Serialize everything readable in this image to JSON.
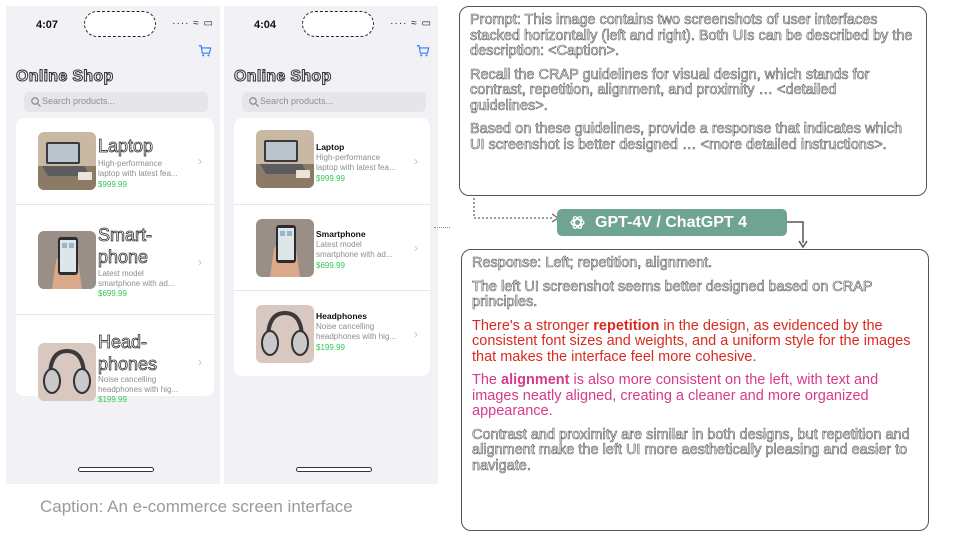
{
  "phones": {
    "left": {
      "time": "4:07",
      "status_icons": "····  ≈  ▭",
      "title": "Online Shop",
      "search_placeholder": "Search products...",
      "items": [
        {
          "name_lines": [
            "Laptop"
          ],
          "desc_lines": [
            "High-performance",
            "laptop with latest fea..."
          ],
          "price": "$999.99",
          "image": "laptop-image"
        },
        {
          "name_lines": [
            "Smart-",
            "phone"
          ],
          "desc_lines": [
            "Latest model",
            "smartphone with ad..."
          ],
          "price": "$699.99",
          "image": "smartphone-image"
        },
        {
          "name_lines": [
            "Head-",
            "phones"
          ],
          "desc_lines": [
            "Noise cancelling",
            "headphones with hig..."
          ],
          "price": "$199.99",
          "image": "headphones-image"
        }
      ]
    },
    "right": {
      "time": "4:04",
      "status_icons": "····  ≈  ▭",
      "title": "Online Shop",
      "search_placeholder": "Search products...",
      "items": [
        {
          "name_lines": [
            "Laptop"
          ],
          "desc_lines": [
            "High-performance",
            "laptop with latest fea..."
          ],
          "price": "$999.99",
          "image": "laptop-image"
        },
        {
          "name_lines": [
            "Smartphone"
          ],
          "desc_lines": [
            "Latest model",
            "smartphone with ad..."
          ],
          "price": "$699.99",
          "image": "smartphone-image"
        },
        {
          "name_lines": [
            "Headphones"
          ],
          "desc_lines": [
            "Noise cancelling",
            "headphones with hig..."
          ],
          "price": "$199.99",
          "image": "headphones-image"
        }
      ]
    }
  },
  "caption": "Caption: An e-commerce screen interface",
  "prompt": {
    "label": "Prompt",
    "p1": ": This image contains two screenshots of user interfaces stacked horizontally (left and right). Both UIs can be described by the description: <Caption>.",
    "p2": "Recall the CRAP guidelines for visual design, which stands for contrast, repetition, alignment, and proximity … <detailed guidelines>.",
    "p3": "Based on these guidelines, provide a response that indicates which UI screenshot is better designed … <more detailed instructions>."
  },
  "model_badge": "GPT-4V / ChatGPT 4",
  "response": {
    "label": "Response",
    "p1_rest": ": Left; repetition, alignment.",
    "p2": "The left UI screenshot seems better designed based on CRAP principles.",
    "p3_pre": "There's a stronger ",
    "p3_bold": "repetition",
    "p3_post": " in the design, as evidenced by the consistent font sizes and weights, and a uniform style for the images that makes the interface feel more cohesive.",
    "p4_pre": "The ",
    "p4_bold": "alignment",
    "p4_post": " is also more consistent on the left, with text and images neatly aligned, creating a cleaner and more organized appearance.",
    "p5": "Contrast and proximity are similar in both designs, but repetition and alignment make the left UI more aesthetically pleasing and easier to navigate."
  },
  "colors": {
    "badge": "#6fa392",
    "price": "#34c759",
    "repetition_text": "#d92b1f",
    "alignment_text": "#d63a8a"
  }
}
